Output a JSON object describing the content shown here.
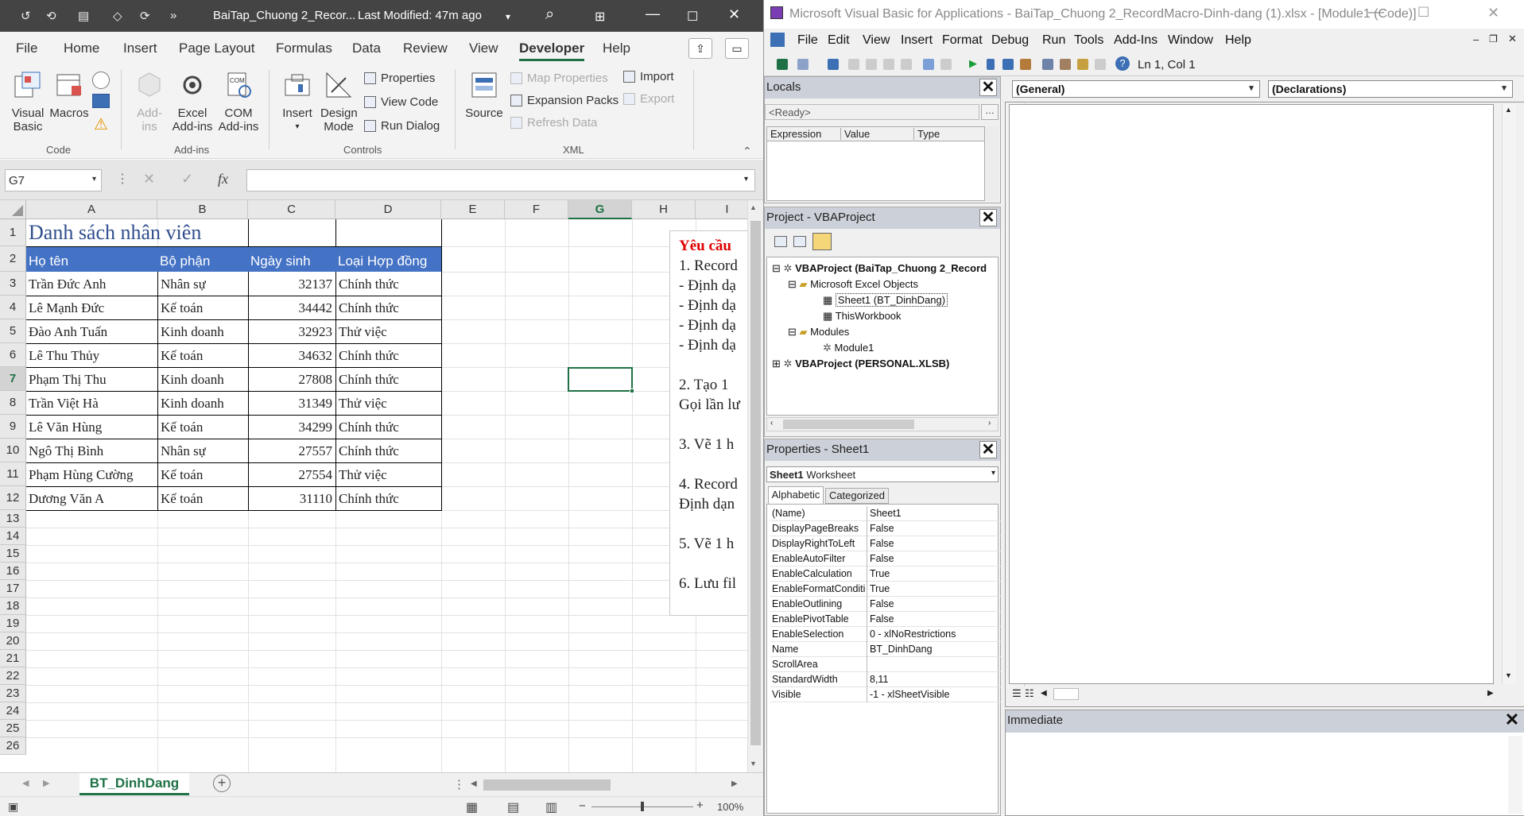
{
  "excel": {
    "title_file": "BaiTap_Chuong 2_Recor...",
    "title_modified": "Last Modified: 47m ago",
    "menu_tabs": [
      "File",
      "Home",
      "Insert",
      "Page Layout",
      "Formulas",
      "Data",
      "Review",
      "View",
      "Developer",
      "Help"
    ],
    "active_tab": "Developer",
    "ribbon": {
      "code_group": "Code",
      "addins_group": "Add-ins",
      "controls_group": "Controls",
      "xml_group": "XML",
      "visual_basic": "Visual Basic",
      "macros": "Macros",
      "add_ins": "Add-ins",
      "excel_add_ins": "Excel Add-ins",
      "com_add_ins": "COM Add-ins",
      "insert": "Insert",
      "design_mode": "Design Mode",
      "properties": "Properties",
      "view_code": "View Code",
      "run_dialog": "Run Dialog",
      "source": "Source",
      "map_properties": "Map Properties",
      "expansion_packs": "Expansion Packs",
      "refresh_data": "Refresh Data",
      "import": "Import",
      "export": "Export"
    },
    "name_box": "G7",
    "formula_symbol": "fx",
    "columns": [
      "A",
      "B",
      "C",
      "D",
      "E",
      "F",
      "G",
      "H",
      "I"
    ],
    "selected_column": "G",
    "rows": [
      "1",
      "2",
      "3",
      "4",
      "5",
      "6",
      "7",
      "8",
      "9",
      "10",
      "11",
      "12",
      "13",
      "14",
      "15",
      "16",
      "17",
      "18",
      "19",
      "20",
      "21",
      "22",
      "23",
      "24",
      "25",
      "26"
    ],
    "selected_row": "7",
    "sheet_title": "Danh sách nhân viên",
    "table_headers": [
      "Họ tên",
      "Bộ phận",
      "Ngày sinh",
      "Loại Hợp đồng"
    ],
    "table_rows": [
      [
        "Trần Đức Anh",
        "Nhân sự",
        "32137",
        "Chính thức"
      ],
      [
        "Lê Mạnh Đức",
        "Kế toán",
        "34442",
        "Chính thức"
      ],
      [
        "Đào Anh Tuấn",
        "Kinh doanh",
        "32923",
        "Thử việc"
      ],
      [
        "Lê Thu Thủy",
        "Kế toán",
        "34632",
        "Chính thức"
      ],
      [
        "Phạm Thị Thu",
        "Kinh doanh",
        "27808",
        "Chính thức"
      ],
      [
        "Trần Việt Hà",
        "Kinh doanh",
        "31349",
        "Thử việc"
      ],
      [
        "Lê Văn Hùng",
        "Kế toán",
        "34299",
        "Chính thức"
      ],
      [
        "Ngô Thị Bình",
        "Nhân sự",
        "27557",
        "Chính thức"
      ],
      [
        "Phạm Hùng Cường",
        "Kế toán",
        "27554",
        "Thử việc"
      ],
      [
        "Dương Văn A",
        "Kế toán",
        "31110",
        "Chính thức"
      ]
    ],
    "textbox_title": "Yêu cầu",
    "textbox_lines": [
      "1. Record",
      "- Định dạ",
      "- Định dạ",
      "- Định dạ",
      "- Định dạ",
      "",
      "2. Tạo 1",
      "Gọi lần lư",
      "",
      "3. Vẽ 1 h",
      "",
      "4. Record",
      "Định dạn",
      "",
      "5. Vẽ 1 h",
      "",
      "6. Lưu fil"
    ],
    "sheet_tab": "BT_DinhDang",
    "zoom": "100%",
    "colors": {
      "header_fill": "#4472c4",
      "accent": "#1e7145",
      "textbox_title": "#e00000"
    }
  },
  "vba": {
    "title": "Microsoft Visual Basic for Applications - BaiTap_Chuong 2_RecordMacro-Dinh-dang (1).xlsx - [Module1 (Code)]",
    "menu": [
      "File",
      "Edit",
      "View",
      "Insert",
      "Format",
      "Debug",
      "Run",
      "Tools",
      "Add-Ins",
      "Window",
      "Help"
    ],
    "cursor_pos": "Ln 1, Col 1",
    "locals": {
      "title": "Locals",
      "ready": "<Ready>",
      "columns": [
        "Expression",
        "Value",
        "Type"
      ]
    },
    "project": {
      "title": "Project - VBAProject",
      "nodes": [
        {
          "label": "VBAProject (BaiTap_Chuong 2_Record",
          "bold": true
        },
        {
          "label": "Microsoft Excel Objects",
          "bold": false
        },
        {
          "label": "Sheet1 (BT_DinhDang)",
          "bold": false
        },
        {
          "label": "ThisWorkbook",
          "bold": false
        },
        {
          "label": "Modules",
          "bold": false
        },
        {
          "label": "Module1",
          "bold": false
        },
        {
          "label": "VBAProject (PERSONAL.XLSB)",
          "bold": true
        }
      ]
    },
    "properties": {
      "title": "Properties - Sheet1",
      "object_name": "Sheet1",
      "object_type": "Worksheet",
      "tab_alpha": "Alphabetic",
      "tab_cat": "Categorized",
      "rows": [
        [
          "(Name)",
          "Sheet1"
        ],
        [
          "DisplayPageBreaks",
          "False"
        ],
        [
          "DisplayRightToLeft",
          "False"
        ],
        [
          "EnableAutoFilter",
          "False"
        ],
        [
          "EnableCalculation",
          "True"
        ],
        [
          "EnableFormatConditionsC",
          "True"
        ],
        [
          "EnableOutlining",
          "False"
        ],
        [
          "EnablePivotTable",
          "False"
        ],
        [
          "EnableSelection",
          "0 - xlNoRestrictions"
        ],
        [
          "Name",
          "BT_DinhDang"
        ],
        [
          "ScrollArea",
          ""
        ],
        [
          "StandardWidth",
          "8,11"
        ],
        [
          "Visible",
          "-1 - xlSheetVisible"
        ]
      ]
    },
    "code": {
      "general": "(General)",
      "declarations": "(Declarations)"
    },
    "immediate": "Immediate"
  }
}
